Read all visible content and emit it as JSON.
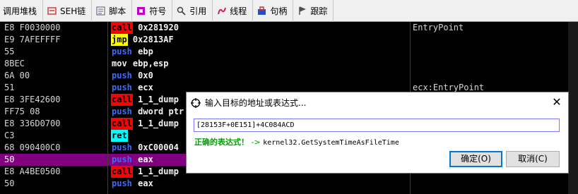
{
  "tabs": [
    {
      "label": "调用堆栈",
      "icon": "none"
    },
    {
      "label": "SEH链",
      "icon": "seh-chain-icon",
      "color": "#d04040"
    },
    {
      "label": "脚本",
      "icon": "script-icon",
      "color": "#505070"
    },
    {
      "label": "符号",
      "icon": "symbol-icon",
      "color": "#c000c0"
    },
    {
      "label": "引用",
      "icon": "search-icon",
      "color": "#404040"
    },
    {
      "label": "线程",
      "icon": "thread-icon",
      "color": "#d02060"
    },
    {
      "label": "句柄",
      "icon": "handle-icon",
      "color": "#2050d0"
    },
    {
      "label": "跟踪",
      "icon": "trace-icon",
      "color": "#505050"
    }
  ],
  "disasm": [
    {
      "hex": "E8 F0030000",
      "mn": "call",
      "ops": "0x281920",
      "cmt": "EntryPoint",
      "cls": "m-call"
    },
    {
      "hex": "E9 7AFEFFFF",
      "mn": "jmp",
      "ops": "0x2813AF",
      "cmt": "",
      "cls": "m-jmp"
    },
    {
      "hex": "55",
      "mn": "push",
      "ops": "ebp",
      "cmt": "",
      "cls": "m-push"
    },
    {
      "hex": "8BEC",
      "mn": "mov",
      "ops": "ebp,esp",
      "cmt": "",
      "cls": "m-mov"
    },
    {
      "hex": "6A 00",
      "mn": "push",
      "ops": "0x0",
      "cmt": "",
      "cls": "m-push"
    },
    {
      "hex": "51",
      "mn": "push",
      "ops": "ecx",
      "cmt": "ecx:EntryPoint",
      "cls": "m-push"
    },
    {
      "hex": "E8 3FE42600",
      "mn": "call",
      "ops": "1_1_dump",
      "cmt": "",
      "cls": "m-call"
    },
    {
      "hex": "FF75 08",
      "mn": "push",
      "ops": "dword ptr",
      "cmt": "",
      "cls": "m-push"
    },
    {
      "hex": "E8 336D0700",
      "mn": "call",
      "ops": "1_1_dump",
      "cmt": "",
      "cls": "m-call"
    },
    {
      "hex": "C3",
      "mn": "ret",
      "ops": "",
      "cmt": "",
      "cls": "m-ret"
    },
    {
      "hex": "68 090400C0",
      "mn": "push",
      "ops": "0xC00004",
      "cmt": "",
      "cls": "m-push"
    },
    {
      "hex": "50",
      "mn": "push",
      "ops": "eax",
      "cmt": "",
      "cls": "m-push",
      "selected": true
    },
    {
      "hex": "E8 A4BE0500",
      "mn": "call",
      "ops": "1_1_dump",
      "cmt": "",
      "cls": "m-call"
    },
    {
      "hex": "50",
      "mn": "push",
      "ops": "eax",
      "cmt": "",
      "cls": "m-push"
    }
  ],
  "dialog": {
    "title": "输入目标的地址或表达式...",
    "close": "✕",
    "input_value": "[28153F+0E151]+4C084ACD",
    "status_ok": "正确的表达式！",
    "status_arrow": " -> ",
    "status_result": "kernel32.GetSystemTimeAsFileTime",
    "ok_label": "确定(O)",
    "cancel_label": "取消(C)"
  }
}
